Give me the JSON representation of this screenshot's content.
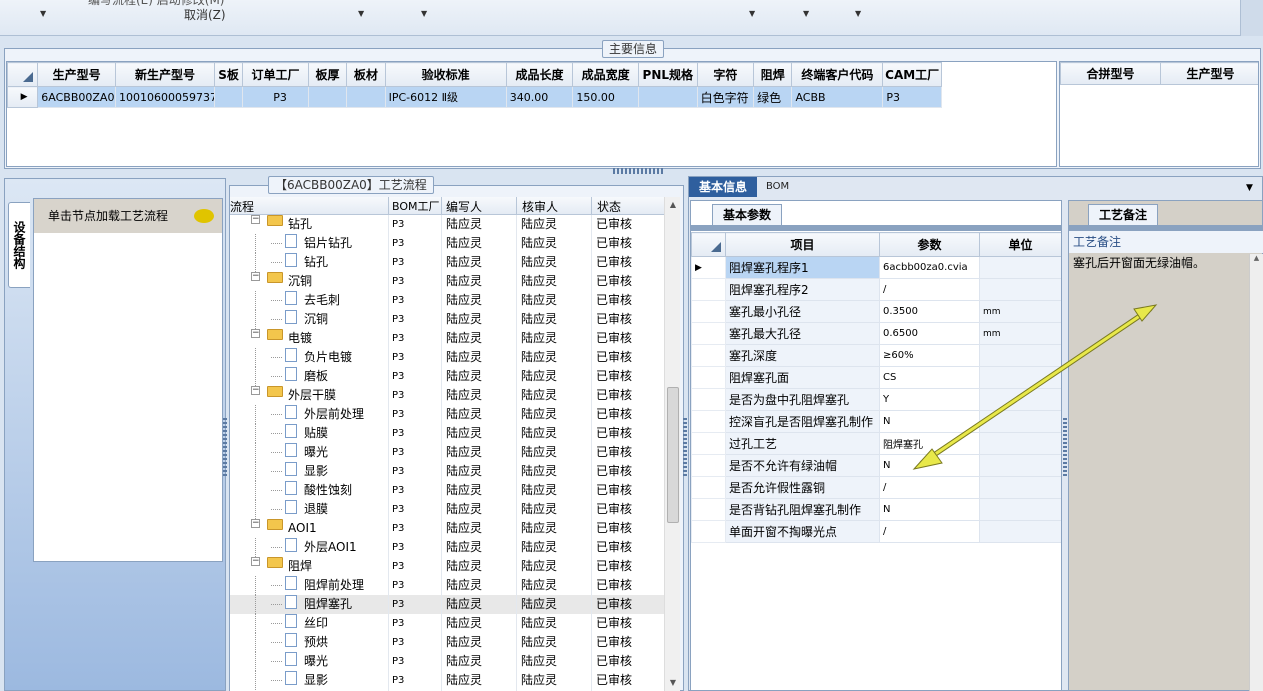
{
  "toolbar": {
    "cut_text": "编写流程(E)  启动修改(M)",
    "cancel_label": "取消(Z)"
  },
  "main_info": {
    "title": "主要信息",
    "columns": [
      "生产型号",
      "新生产型号",
      "S板",
      "订单工厂",
      "板厚",
      "板材",
      "验收标准",
      "成品长度",
      "成品宽度",
      "PNL规格",
      "字符",
      "阻焊",
      "终端客户代码",
      "CAM工厂"
    ],
    "rows": [
      [
        "6ACBB00ZA0",
        "10010600059737",
        "",
        "P3",
        "",
        "",
        "IPC-6012 Ⅱ级",
        "340.00",
        "150.00",
        "",
        "白色字符",
        "绿色",
        "ACBB",
        "P3"
      ]
    ]
  },
  "merge_table": {
    "columns": [
      "合拼型号",
      "生产型号"
    ]
  },
  "left_tab": {
    "vertical_label": "设备结构",
    "hint": "单击节点加载工艺流程"
  },
  "flow": {
    "title": "【6ACBB00ZA0】工艺流程",
    "columns": [
      "流程",
      "BOM工厂",
      "编写人",
      "核审人",
      "状态"
    ],
    "rows": [
      {
        "level": 0,
        "name": "钻孔",
        "bom": "P3",
        "writer": "陆应灵",
        "reviewer": "陆应灵",
        "status": "已审核"
      },
      {
        "level": 1,
        "name": "铝片钻孔",
        "bom": "P3",
        "writer": "陆应灵",
        "reviewer": "陆应灵",
        "status": "已审核"
      },
      {
        "level": 1,
        "name": "钻孔",
        "bom": "P3",
        "writer": "陆应灵",
        "reviewer": "陆应灵",
        "status": "已审核"
      },
      {
        "level": 0,
        "name": "沉铜",
        "bom": "P3",
        "writer": "陆应灵",
        "reviewer": "陆应灵",
        "status": "已审核"
      },
      {
        "level": 1,
        "name": "去毛刺",
        "bom": "P3",
        "writer": "陆应灵",
        "reviewer": "陆应灵",
        "status": "已审核"
      },
      {
        "level": 1,
        "name": "沉铜",
        "bom": "P3",
        "writer": "陆应灵",
        "reviewer": "陆应灵",
        "status": "已审核"
      },
      {
        "level": 0,
        "name": "电镀",
        "bom": "P3",
        "writer": "陆应灵",
        "reviewer": "陆应灵",
        "status": "已审核"
      },
      {
        "level": 1,
        "name": "负片电镀",
        "bom": "P3",
        "writer": "陆应灵",
        "reviewer": "陆应灵",
        "status": "已审核"
      },
      {
        "level": 1,
        "name": "磨板",
        "bom": "P3",
        "writer": "陆应灵",
        "reviewer": "陆应灵",
        "status": "已审核"
      },
      {
        "level": 0,
        "name": "外层干膜",
        "bom": "P3",
        "writer": "陆应灵",
        "reviewer": "陆应灵",
        "status": "已审核"
      },
      {
        "level": 1,
        "name": "外层前处理",
        "bom": "P3",
        "writer": "陆应灵",
        "reviewer": "陆应灵",
        "status": "已审核"
      },
      {
        "level": 1,
        "name": "贴膜",
        "bom": "P3",
        "writer": "陆应灵",
        "reviewer": "陆应灵",
        "status": "已审核"
      },
      {
        "level": 1,
        "name": "曝光",
        "bom": "P3",
        "writer": "陆应灵",
        "reviewer": "陆应灵",
        "status": "已审核"
      },
      {
        "level": 1,
        "name": "显影",
        "bom": "P3",
        "writer": "陆应灵",
        "reviewer": "陆应灵",
        "status": "已审核"
      },
      {
        "level": 1,
        "name": "酸性蚀刻",
        "bom": "P3",
        "writer": "陆应灵",
        "reviewer": "陆应灵",
        "status": "已审核"
      },
      {
        "level": 1,
        "name": "退膜",
        "bom": "P3",
        "writer": "陆应灵",
        "reviewer": "陆应灵",
        "status": "已审核"
      },
      {
        "level": 0,
        "name": "AOI1",
        "bom": "P3",
        "writer": "陆应灵",
        "reviewer": "陆应灵",
        "status": "已审核"
      },
      {
        "level": 1,
        "name": "外层AOI1",
        "bom": "P3",
        "writer": "陆应灵",
        "reviewer": "陆应灵",
        "status": "已审核"
      },
      {
        "level": 0,
        "name": "阻焊",
        "bom": "P3",
        "writer": "陆应灵",
        "reviewer": "陆应灵",
        "status": "已审核"
      },
      {
        "level": 1,
        "name": "阻焊前处理",
        "bom": "P3",
        "writer": "陆应灵",
        "reviewer": "陆应灵",
        "status": "已审核"
      },
      {
        "level": 1,
        "name": "阻焊塞孔",
        "bom": "P3",
        "writer": "陆应灵",
        "reviewer": "陆应灵",
        "status": "已审核",
        "selected": true
      },
      {
        "level": 1,
        "name": "丝印",
        "bom": "P3",
        "writer": "陆应灵",
        "reviewer": "陆应灵",
        "status": "已审核"
      },
      {
        "level": 1,
        "name": "预烘",
        "bom": "P3",
        "writer": "陆应灵",
        "reviewer": "陆应灵",
        "status": "已审核"
      },
      {
        "level": 1,
        "name": "曝光",
        "bom": "P3",
        "writer": "陆应灵",
        "reviewer": "陆应灵",
        "status": "已审核"
      },
      {
        "level": 1,
        "name": "显影",
        "bom": "P3",
        "writer": "陆应灵",
        "reviewer": "陆应灵",
        "status": "已审核"
      }
    ]
  },
  "right_tabs": {
    "basic": "基本信息",
    "bom": "BOM",
    "params_tab": "基本参数",
    "notes_tab": "工艺备注"
  },
  "params": {
    "columns": [
      "项目",
      "参数",
      "单位"
    ],
    "rows": [
      {
        "item": "阻焊塞孔程序1",
        "value": "6acbb00za0.cvia",
        "unit": ""
      },
      {
        "item": "阻焊塞孔程序2",
        "value": "/",
        "unit": ""
      },
      {
        "item": "塞孔最小孔径",
        "value": "0.3500",
        "unit": "mm"
      },
      {
        "item": "塞孔最大孔径",
        "value": "0.6500",
        "unit": "mm"
      },
      {
        "item": "塞孔深度",
        "value": "≥60%",
        "unit": ""
      },
      {
        "item": "阻焊塞孔面",
        "value": "CS",
        "unit": ""
      },
      {
        "item": "是否为盘中孔阻焊塞孔",
        "value": "Y",
        "unit": ""
      },
      {
        "item": "控深盲孔是否阻焊塞孔制作",
        "value": "N",
        "unit": ""
      },
      {
        "item": "过孔工艺",
        "value": "阻焊塞孔",
        "unit": ""
      },
      {
        "item": "是否不允许有绿油帽",
        "value": "N",
        "unit": ""
      },
      {
        "item": "是否允许假性露铜",
        "value": "/",
        "unit": ""
      },
      {
        "item": "是否背钻孔阻焊塞孔制作",
        "value": "N",
        "unit": ""
      },
      {
        "item": "单面开窗不掏曝光点",
        "value": "/",
        "unit": ""
      }
    ]
  },
  "notes": {
    "header": "工艺备注",
    "text": "塞孔后开窗面无绿油帽。"
  },
  "colors": {
    "arrow": "#e8e84a",
    "selected_row": "#b9d5f3",
    "tab_active": "#2f5f9e"
  }
}
